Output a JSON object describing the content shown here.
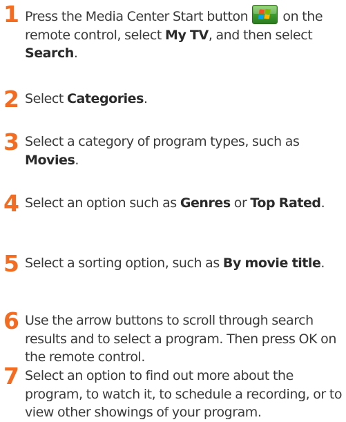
{
  "steps": [
    {
      "number": "1",
      "segments": [
        {
          "text": "Press the Media Center Start button ",
          "bold": false
        },
        {
          "icon": "media-center-start-icon"
        },
        {
          "text": " on the remote control, select ",
          "bold": false
        },
        {
          "text": "My TV",
          "bold": true
        },
        {
          "text": ", and then select ",
          "bold": false
        },
        {
          "text": "Search",
          "bold": true
        },
        {
          "text": ".",
          "bold": false
        }
      ]
    },
    {
      "number": "2",
      "segments": [
        {
          "text": "Select ",
          "bold": false
        },
        {
          "text": "Categories",
          "bold": true
        },
        {
          "text": ".",
          "bold": false
        }
      ]
    },
    {
      "number": "3",
      "segments": [
        {
          "text": "Select a category of program types, such as ",
          "bold": false
        },
        {
          "text": "Movies",
          "bold": true
        },
        {
          "text": ".",
          "bold": false
        }
      ]
    },
    {
      "number": "4",
      "segments": [
        {
          "text": "Select an option such as ",
          "bold": false
        },
        {
          "text": "Genres",
          "bold": true
        },
        {
          "text": " or ",
          "bold": false
        },
        {
          "text": "Top Rated",
          "bold": true
        },
        {
          "text": ".",
          "bold": false
        }
      ]
    },
    {
      "number": "5",
      "segments": [
        {
          "text": "Select a sorting option, such as ",
          "bold": false
        },
        {
          "text": "By movie title",
          "bold": true
        },
        {
          "text": ".",
          "bold": false
        }
      ]
    },
    {
      "number": "6",
      "segments": [
        {
          "text": "Use the arrow buttons to scroll through search results and to select a program. Then press OK on the remote control.",
          "bold": false
        }
      ]
    },
    {
      "number": "7",
      "segments": [
        {
          "text": "Select an option to find out more about the program, to watch it, to schedule a recording, or to view other showings of your program.",
          "bold": false
        }
      ]
    }
  ],
  "colors": {
    "step_number": "#f26d21",
    "body_text": "#3a3a3a",
    "start_button_green": "#3f9b2f"
  }
}
